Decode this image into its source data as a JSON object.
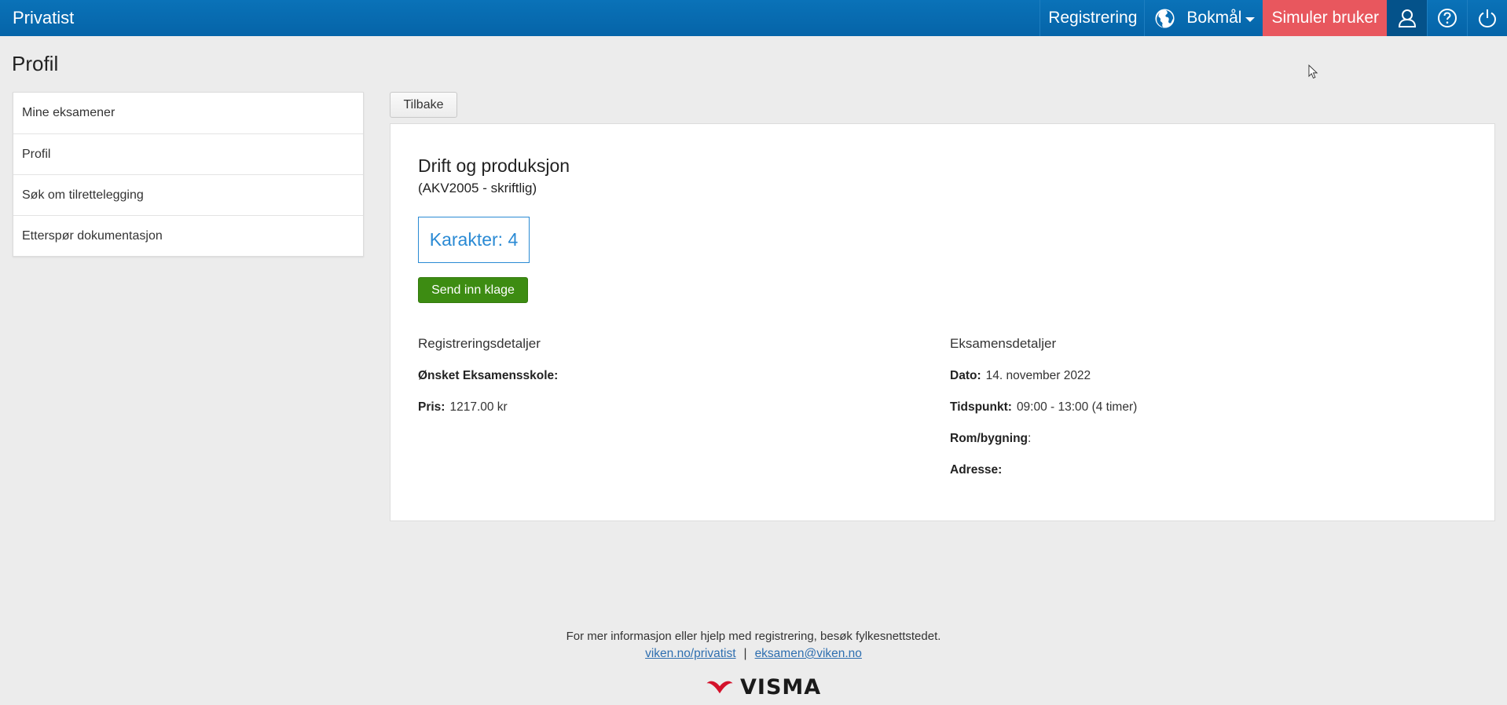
{
  "topbar": {
    "brand": "Privatist",
    "registration_label": "Registrering",
    "language_label": "Bokmål",
    "simulate_label": "Simuler bruker",
    "icons": [
      "globe-icon",
      "user-icon",
      "help-icon",
      "power-icon"
    ],
    "colors": {
      "bar": "#0a6db3",
      "simulate": "#e8575e",
      "user_active": "#04528a"
    }
  },
  "page": {
    "title": "Profil"
  },
  "sidebar": {
    "items": [
      {
        "label": "Mine eksamener"
      },
      {
        "label": "Profil"
      },
      {
        "label": "Søk om tilrettelegging"
      },
      {
        "label": "Etterspør dokumentasjon"
      }
    ]
  },
  "main": {
    "back_label": "Tilbake",
    "course_title": "Drift og produksjon",
    "course_code": "(AKV2005 - skriftlig)",
    "grade": "Karakter: 4",
    "complaint_label": "Send inn klage",
    "registration": {
      "heading": "Registreringsdetaljer",
      "school_label": "Ønsket Eksamensskole:",
      "school_value": "",
      "price_label": "Pris:",
      "price_value": "1217.00 kr"
    },
    "exam": {
      "heading": "Eksamensdetaljer",
      "date_label": "Dato:",
      "date_value": "14. november 2022",
      "time_label": "Tidspunkt:",
      "time_value": "09:00 - 13:00 (4 timer)",
      "room_label": "Rom/bygning",
      "room_suffix": ":",
      "address_label": "Adresse:"
    }
  },
  "footer": {
    "info": "For mer informasjon eller hjelp med registrering, besøk fylkesnettstedet.",
    "link1": "viken.no/privatist",
    "separator": "|",
    "link2": "eksamen@viken.no",
    "logo_text": "VISMA"
  }
}
